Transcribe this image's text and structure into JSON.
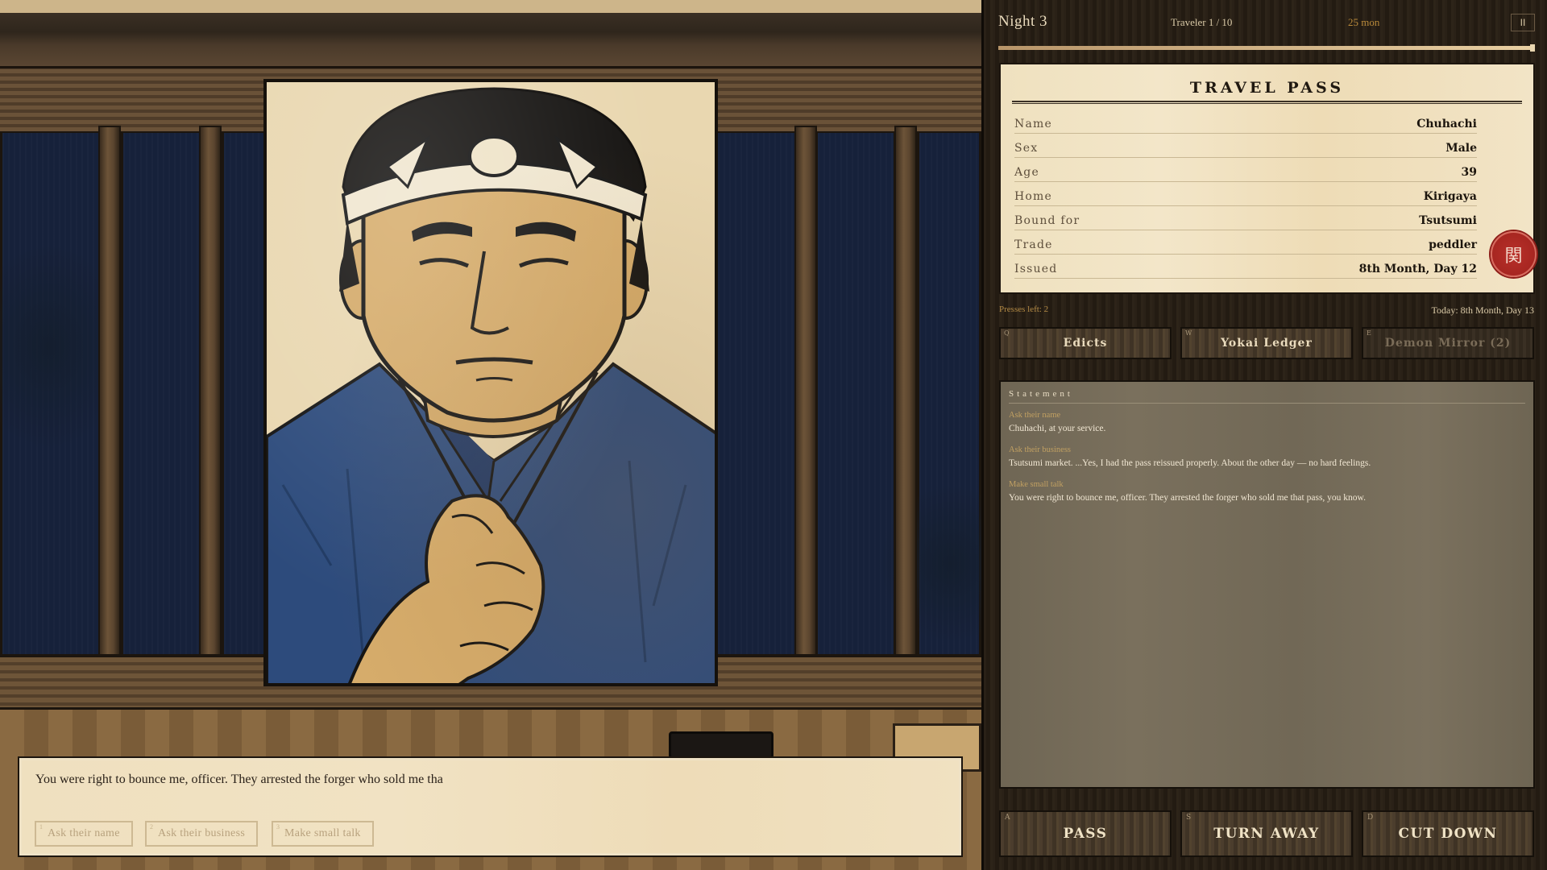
{
  "header": {
    "night": "Night 3",
    "traveler": "Traveler 1 / 10",
    "money": "25 mon",
    "pause_label": "II",
    "progress": 1.0
  },
  "travel_pass": {
    "title": "TRAVEL PASS",
    "fields": [
      {
        "label": "Name",
        "value": "Chuhachi"
      },
      {
        "label": "Sex",
        "value": "Male"
      },
      {
        "label": "Age",
        "value": "39"
      },
      {
        "label": "Home",
        "value": "Kirigaya"
      },
      {
        "label": "Bound for",
        "value": "Tsutsumi"
      },
      {
        "label": "Trade",
        "value": "peddler"
      },
      {
        "label": "Issued",
        "value": "8th Month, Day 12"
      }
    ],
    "seal_glyph": "関"
  },
  "status": {
    "presses_left": "Presses left: 2",
    "today": "Today: 8th Month, Day 13"
  },
  "tools": [
    {
      "key": "Q",
      "label": "Edicts",
      "enabled": true
    },
    {
      "key": "W",
      "label": "Yokai Ledger",
      "enabled": true
    },
    {
      "key": "E",
      "label": "Demon Mirror (2)",
      "enabled": false
    }
  ],
  "statement": {
    "title": "Statement",
    "entries": [
      {
        "question": "Ask their name",
        "answer": "Chuhachi, at your service."
      },
      {
        "question": "Ask their business",
        "answer": "Tsutsumi market. ...Yes, I had the pass reissued properly. About the other day — no hard feelings."
      },
      {
        "question": "Make small talk",
        "answer": "You were right to bounce me, officer. They arrested the forger who sold me that pass, you know."
      }
    ]
  },
  "dialogue": {
    "text": "You were right to bounce me, officer. They arrested the forger who sold me tha",
    "options": [
      {
        "key": "1",
        "label": "Ask their name"
      },
      {
        "key": "2",
        "label": "Ask their business"
      },
      {
        "key": "3",
        "label": "Make small talk"
      }
    ]
  },
  "actions": [
    {
      "key": "A",
      "label": "PASS"
    },
    {
      "key": "S",
      "label": "TURN AWAY"
    },
    {
      "key": "D",
      "label": "CUT DOWN"
    }
  ],
  "colors": {
    "seal_red": "#a8261f",
    "money_gold": "#b8893a",
    "kimono_blue": "#2c4a7a"
  }
}
